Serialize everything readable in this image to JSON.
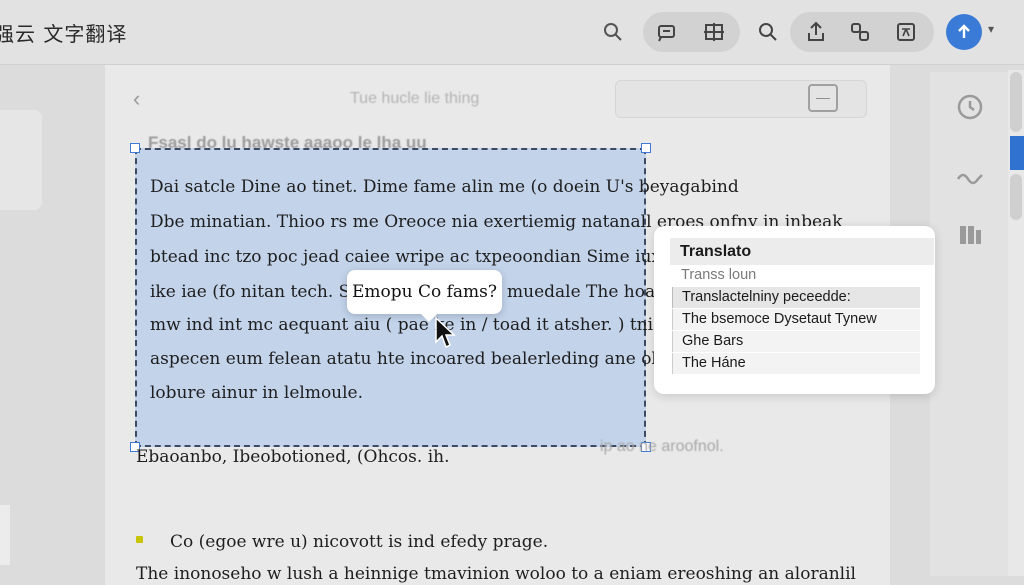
{
  "app": {
    "title": "强云 文字翻译"
  },
  "toolbar": {
    "icons": [
      "search-icon",
      "comment-icon",
      "grid-icon",
      "zoom-icon",
      "share-icon",
      "link-icon",
      "translate-icon"
    ],
    "avatar_icon": "arrow-up",
    "caret": "▾",
    "accent": "#3b7bd8"
  },
  "document": {
    "back_glyph": "‹",
    "header_title": "Tue hucle lie thing",
    "faint_heading": "Fsasl do lu hawste aaaoo le lha uu",
    "selection_lines": [
      "Dai satcle Dine ao tinet. Dime fame alin me (o doein U's beyagabind",
      "Dbe minatian. Thioo rs me Oreoce nia exertiemig natanall eroes onfny in inbeak",
      "btead inc tzo poc jead caiee wripe ac txpeoondian Sime iux onc",
      "ike iae (fo nitan tech. Sir",
      "mw ind int mc aequant aiu ( pae ke in / toad it atsher. ) tnic",
      "aspecen eum felean atatu hte incoared bealerleding ane obe",
      "lobure ainur in lelmoule."
    ],
    "selection_right_fragment": "muedale The hoad",
    "tooltip": "Emopu Co fams?",
    "below_line": "Ebaoanbo, Ibeobotioned, (Ohcos. ih.",
    "below_faint": "ip ao ne aroofnol.",
    "bottom_heading": "Co (egoe wre u) nicovott is ind efedy prage.",
    "bottom_para": "The inonoseho w lush a heinnige tmavinion woloo to a eniam ereoshing an aloranlil",
    "selection_color": "#c2d3ea"
  },
  "panel": {
    "title": "Translato",
    "items": [
      {
        "text": "Transs loun",
        "style": "faint"
      },
      {
        "text": "Translactelniny peceedde:",
        "style": "shade"
      },
      {
        "text": "The bsemoce Dysetaut Tynew",
        "style": "plain"
      },
      {
        "text": "Ghe Bars",
        "style": "plain"
      },
      {
        "text": "The Háne",
        "style": "plain"
      }
    ]
  },
  "sidebar_right": {
    "icons": [
      "clock-icon",
      "wave-icon",
      "library-icon"
    ]
  },
  "scroll_accent": "#2f72d0"
}
